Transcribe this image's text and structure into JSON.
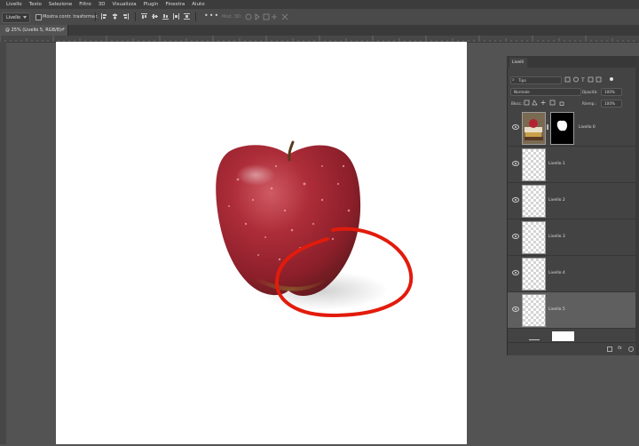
{
  "menu": [
    "Livello",
    "Testo",
    "Selezione",
    "Filtro",
    "3D",
    "Visualizza",
    "Plugin",
    "Finestra",
    "Aiuto"
  ],
  "options_bar": {
    "tool_preset": "Livello",
    "show_transform_label": "Mostra contr. trasformaz.",
    "mode_3d_label": "Mod. 3D:"
  },
  "document_tab": {
    "title": "@ 25% (Livello 5, RGB/8) *",
    "close": "×"
  },
  "layers_panel": {
    "tab": "Livelli",
    "filter_label": "Tipo",
    "blend_mode": "Normale",
    "opacity_label": "Opacità:",
    "opacity_value": "100%",
    "lock_label": "Blocc.:",
    "fill_label": "Riemp.:",
    "fill_value": "100%",
    "layers": [
      {
        "name": "Livello 0",
        "kind": "photo-with-mask",
        "selected": false
      },
      {
        "name": "Livello 1",
        "kind": "transparent",
        "selected": false
      },
      {
        "name": "Livello 2",
        "kind": "transparent",
        "selected": false
      },
      {
        "name": "Livello 3",
        "kind": "transparent",
        "selected": false
      },
      {
        "name": "Livello 4",
        "kind": "transparent",
        "selected": false
      },
      {
        "name": "Livello 5",
        "kind": "transparent",
        "selected": true
      }
    ],
    "footer_fx": "fx"
  },
  "colors": {
    "app_bg": "#535353",
    "panel_bg": "#434343",
    "apple_red": "#a82a35",
    "circle_red": "#e21b0c"
  }
}
